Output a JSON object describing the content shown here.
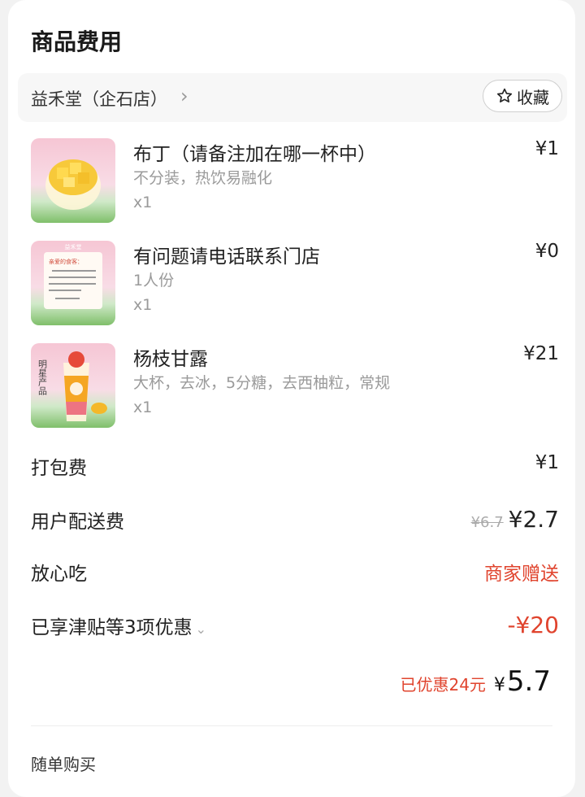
{
  "section_title": "商品费用",
  "store": {
    "name": "益禾堂（企石店）",
    "favorite_label": "收藏"
  },
  "items": [
    {
      "name": "布丁（请备注加在哪一杯中）",
      "spec": "不分装，热饮易融化",
      "qty": "x1",
      "price": "¥1"
    },
    {
      "name": "有问题请电话联系门店",
      "spec": "1人份",
      "qty": "x1",
      "price": "¥0"
    },
    {
      "name": "杨枝甘露",
      "spec": "大杯，去冰，5分糖，去西柚粒，常规",
      "qty": "x1",
      "price": "¥21"
    }
  ],
  "thumb_texts": {
    "item2_brand": "益禾堂",
    "item2_greeting": "亲爱的食客：",
    "item3_badge": "明星产品"
  },
  "fees": {
    "packing": {
      "label": "打包费",
      "value": "¥1"
    },
    "delivery": {
      "label": "用户配送费",
      "original": "¥6.7",
      "value": "¥2.7"
    },
    "safe_eat": {
      "label": "放心吃",
      "value": "商家赠送"
    },
    "discount": {
      "label": "已享津贴等3项优惠",
      "value": "-¥20"
    }
  },
  "summary": {
    "saved": "已优惠24元",
    "total_yen": "¥",
    "total_value": "5.7"
  },
  "next_section": "随单购买",
  "colors": {
    "accent_red": "#e0442e",
    "text_main": "#222222",
    "text_muted": "#9a9a9a"
  }
}
